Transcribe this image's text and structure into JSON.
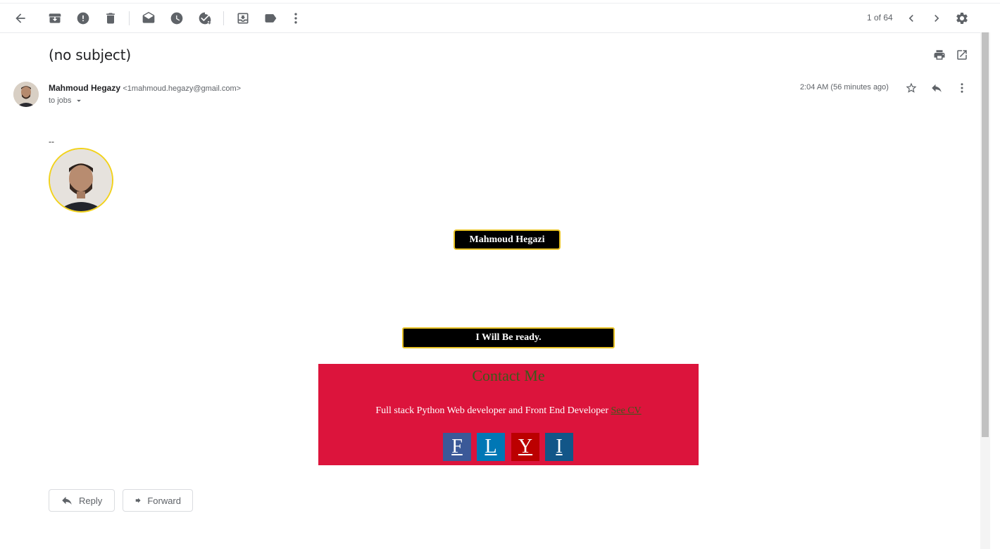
{
  "toolbar": {
    "back": "back-arrow-icon",
    "icons": [
      "archive-icon",
      "report-spam-icon",
      "delete-icon",
      "mark-unread-icon",
      "snooze-icon",
      "add-to-tasks-icon",
      "move-to-icon",
      "label-icon",
      "more-icon"
    ],
    "pager": "1 of 64"
  },
  "email": {
    "subject": "(no subject)",
    "sender_name": "Mahmoud Hegazy",
    "sender_email": "<1mahmoud.hegazy@gmail.com>",
    "to": "to jobs",
    "time": "2:04 AM (56 minutes ago)"
  },
  "signature": {
    "dashes": "--",
    "name_badge": "Mahmoud Hegazi",
    "ready_badge": "I Will Be ready.",
    "contact_title": "Contact Me",
    "description": "Full stack Python Web developer and Front End Developer",
    "cv_link": "See CV",
    "social": [
      {
        "letter": "F",
        "color": "#3b5998"
      },
      {
        "letter": "L",
        "color": "#0077b5"
      },
      {
        "letter": "Y",
        "color": "#bb0000"
      },
      {
        "letter": "I",
        "color": "#125688"
      }
    ]
  },
  "actions": {
    "reply": "Reply",
    "forward": "Forward"
  },
  "colors": {
    "contact_bg": "#dc143c",
    "badge_border": "#e8c225"
  }
}
